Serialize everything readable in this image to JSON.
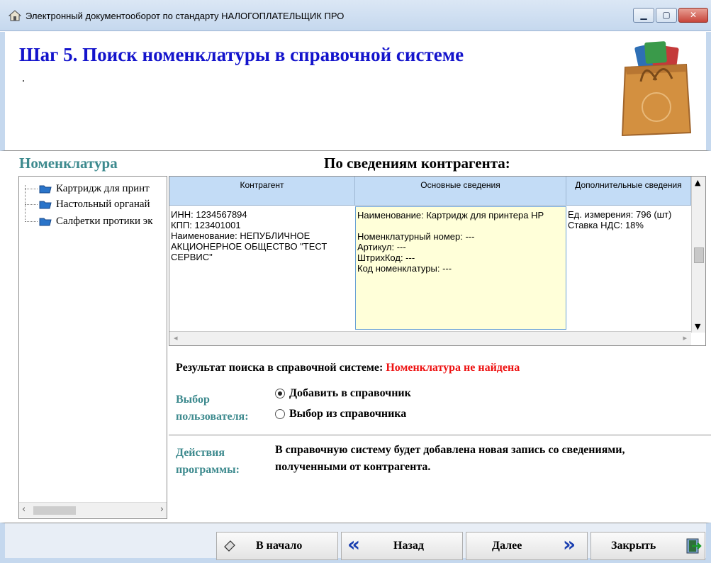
{
  "window": {
    "title": "Электронный документооборот по стандарту НАЛОГОПЛАТЕЛЬЩИК ПРО",
    "minimize_glyph": "▁",
    "maximize_glyph": "▢",
    "close_glyph": "✕"
  },
  "header": {
    "step_title": "Шаг 5. Поиск номенклатуры в справочной системе",
    "dot": "."
  },
  "left_panel": {
    "title": "Номенклатура",
    "items": [
      {
        "label": "Картридж для принт"
      },
      {
        "label": "Настольный органай"
      },
      {
        "label": "Салфетки протики эк"
      }
    ],
    "scroll_left": "‹",
    "scroll_right": "›"
  },
  "right_panel": {
    "heading": "По сведениям контрагента:",
    "columns": [
      "Контрагент",
      "Основные сведения",
      "Дополнительные сведения"
    ],
    "row": {
      "counterparty": "ИНН: 1234567894\nКПП: 123401001\nНаименование: НЕПУБЛИЧНОЕ АКЦИОНЕРНОЕ ОБЩЕСТВО \"ТЕСТ СЕРВИС\"",
      "main": "Наименование: Картридж для принтера HP\n\nНоменклатурный номер: ---\nАртикул: ---\nШтрихКод: ---\nКод номенклатуры: ---",
      "extra": "Ед. измерения: 796 (шт)\nСтавка НДС: 18%"
    },
    "scroll_up": "▲",
    "scroll_down": "▼",
    "scroll_left": "◂",
    "scroll_right": "▸"
  },
  "result": {
    "prefix": "Результат поиска в справочной системе: ",
    "status": "Номенклатура не найдена",
    "status_color": "#ee1111"
  },
  "user_choice": {
    "label_line1": "Выбор",
    "label_line2": "пользователя:",
    "options": [
      {
        "label": "Добавить в справочник",
        "selected": true
      },
      {
        "label": "Выбор из справочника",
        "selected": false
      }
    ]
  },
  "program_actions": {
    "label_line1": "Действия",
    "label_line2": "программы:",
    "text": "В справочную систему будет добавлена новая запись со сведениями, полученными от контрагента."
  },
  "buttons": {
    "start": "В начало",
    "back": "Назад",
    "next": "Далее",
    "close": "Закрыть",
    "back_glyph": "«",
    "next_glyph": "»"
  }
}
